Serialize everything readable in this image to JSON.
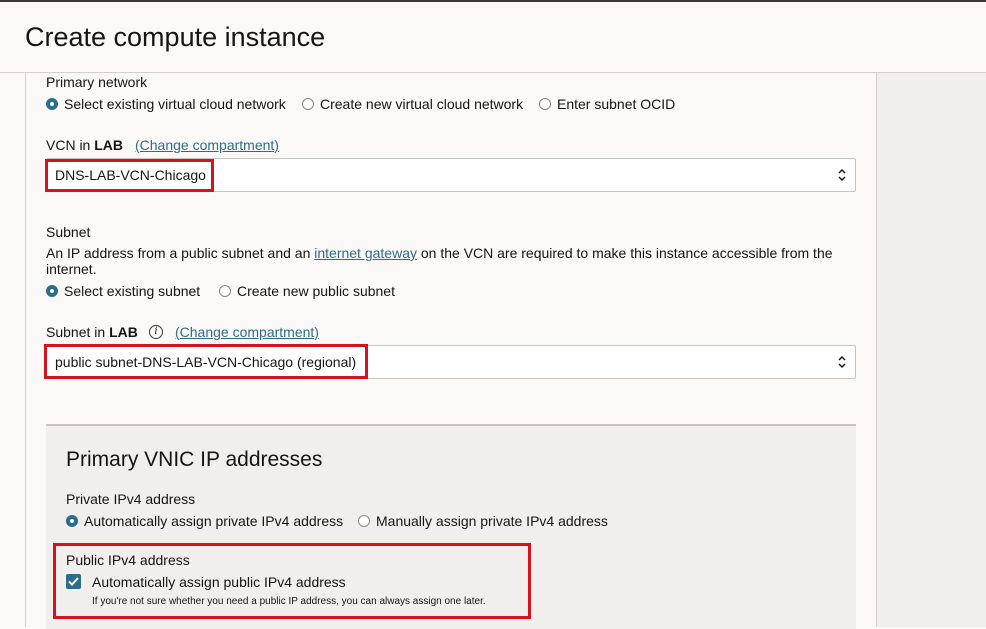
{
  "header": {
    "title": "Create compute instance"
  },
  "primary_network": {
    "label": "Primary network",
    "options": [
      "Select existing virtual cloud network",
      "Create new virtual cloud network",
      "Enter subnet OCID"
    ],
    "selected": 0
  },
  "vcn": {
    "label_prefix": "VCN in ",
    "compartment": "LAB",
    "change_link": "(Change compartment)",
    "value": "DNS-LAB-VCN-Chicago"
  },
  "subnet": {
    "label": "Subnet",
    "help_before": "An IP address from a public subnet and an ",
    "help_link": "internet gateway",
    "help_after": " on the VCN are required to make this instance accessible from the",
    "help_line2": "internet.",
    "options": [
      "Select existing subnet",
      "Create new public subnet"
    ],
    "selected": 0
  },
  "subnet_select": {
    "label_prefix": "Subnet in ",
    "compartment": "LAB",
    "change_link": "(Change compartment)",
    "value": "public subnet-DNS-LAB-VCN-Chicago (regional)"
  },
  "vnic": {
    "title": "Primary VNIC IP addresses",
    "private_label": "Private IPv4 address",
    "private_options": [
      "Automatically assign private IPv4 address",
      "Manually assign private IPv4 address"
    ],
    "private_selected": 0,
    "public_label": "Public IPv4 address",
    "public_checkbox_label": "Automatically assign public IPv4 address",
    "public_checked": true,
    "public_help": "If you're not sure whether you need a public IP address, you can always assign one later."
  },
  "colors": {
    "accent": "#2c6d8c",
    "highlight": "#d3141c"
  }
}
